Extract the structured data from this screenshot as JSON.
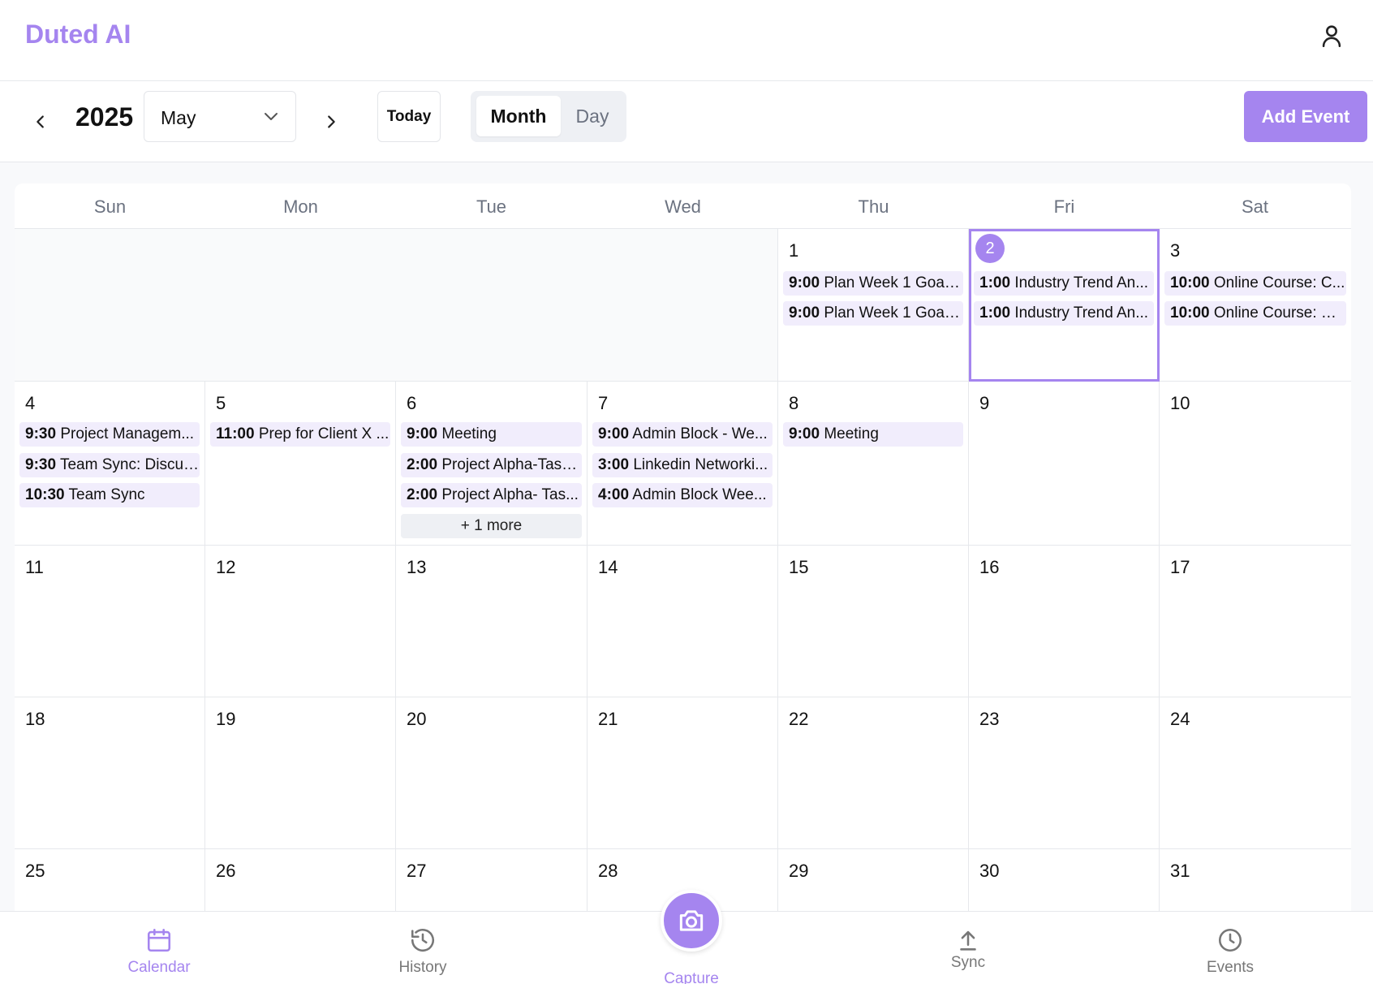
{
  "header": {
    "brand": "Duted AI"
  },
  "toolbar": {
    "year": "2025",
    "month": "May",
    "today_label": "Today",
    "views": [
      "Month",
      "Day"
    ],
    "active_view": "Month",
    "add_event_label": "Add Event"
  },
  "calendar": {
    "weekdays": [
      "Sun",
      "Mon",
      "Tue",
      "Wed",
      "Thu",
      "Fri",
      "Sat"
    ],
    "today": "2",
    "days": {
      "d1": {
        "num": "1",
        "events": [
          {
            "time": "9:00",
            "title": "Plan Week 1 Goals..."
          },
          {
            "time": "9:00",
            "title": "Plan Week 1 Goals..."
          }
        ]
      },
      "d2": {
        "num": "2",
        "events": [
          {
            "time": "1:00",
            "title": "Industry Trend An..."
          },
          {
            "time": "1:00",
            "title": "Industry Trend An..."
          }
        ]
      },
      "d3": {
        "num": "3",
        "events": [
          {
            "time": "10:00",
            "title": "Online Course: C..."
          },
          {
            "time": "10:00",
            "title": "Online Course: Pr..."
          }
        ]
      },
      "d4": {
        "num": "4",
        "events": [
          {
            "time": "9:30",
            "title": "Project Managem..."
          },
          {
            "time": "9:30",
            "title": "Team Sync: Discus..."
          },
          {
            "time": "10:30",
            "title": "Team Sync"
          }
        ]
      },
      "d5": {
        "num": "5",
        "events": [
          {
            "time": "11:00",
            "title": "Prep for Client X ..."
          }
        ]
      },
      "d6": {
        "num": "6",
        "events": [
          {
            "time": "9:00",
            "title": "Meeting"
          },
          {
            "time": "2:00",
            "title": "Project Alpha-Task..."
          },
          {
            "time": "2:00",
            "title": "Project Alpha- Tas..."
          }
        ],
        "more": "+ 1 more"
      },
      "d7": {
        "num": "7",
        "events": [
          {
            "time": "9:00",
            "title": "Admin Block - We..."
          },
          {
            "time": "3:00",
            "title": "Linkedin Networki..."
          },
          {
            "time": "4:00",
            "title": "Admin Block Wee..."
          }
        ]
      },
      "d8": {
        "num": "8",
        "events": [
          {
            "time": "9:00",
            "title": "Meeting"
          }
        ]
      }
    },
    "plain_days": [
      "9",
      "10",
      "11",
      "12",
      "13",
      "14",
      "15",
      "16",
      "17",
      "18",
      "19",
      "20",
      "21",
      "22",
      "23",
      "24",
      "25",
      "26",
      "27",
      "28",
      "29",
      "30",
      "31"
    ]
  },
  "bottom_nav": {
    "calendar": "Calendar",
    "history": "History",
    "capture": "Capture",
    "sync": "Sync",
    "events": "Events"
  },
  "colors": {
    "accent": "#a585ef",
    "event_bg": "#f1edfc",
    "border": "#e6e8ec"
  }
}
